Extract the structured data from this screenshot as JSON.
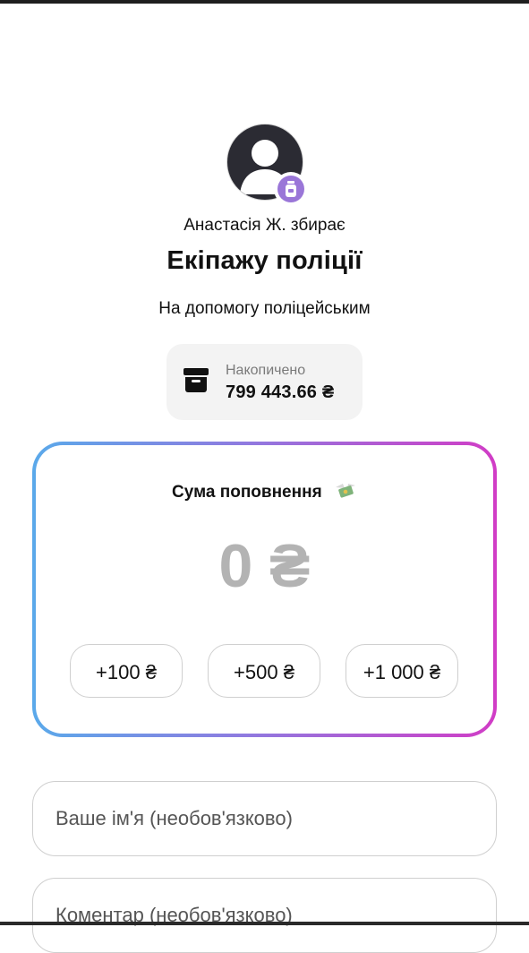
{
  "fundraiser": {
    "collector": "Анастасія Ж. збирає",
    "title": "Екіпажу поліції",
    "description": "На допомогу поліцейським"
  },
  "stats": {
    "label": "Накопичено",
    "amount": "799 443.66 ₴",
    "icon": "archive-box-icon"
  },
  "topup": {
    "title": "Сума поповнення",
    "title_icon": "money-with-wings-icon",
    "amount": "0 ₴",
    "presets": [
      "+100 ₴",
      "+500 ₴",
      "+1 000 ₴"
    ]
  },
  "form": {
    "name_placeholder": "Ваше ім'я (необов'язково)",
    "comment_placeholder": "Коментар (необов'язково)"
  },
  "colors": {
    "gradient_start": "#5aa9ea",
    "gradient_end": "#d13cc6",
    "badge": "#9a76d8",
    "amount_placeholder": "#b3b3b3"
  }
}
